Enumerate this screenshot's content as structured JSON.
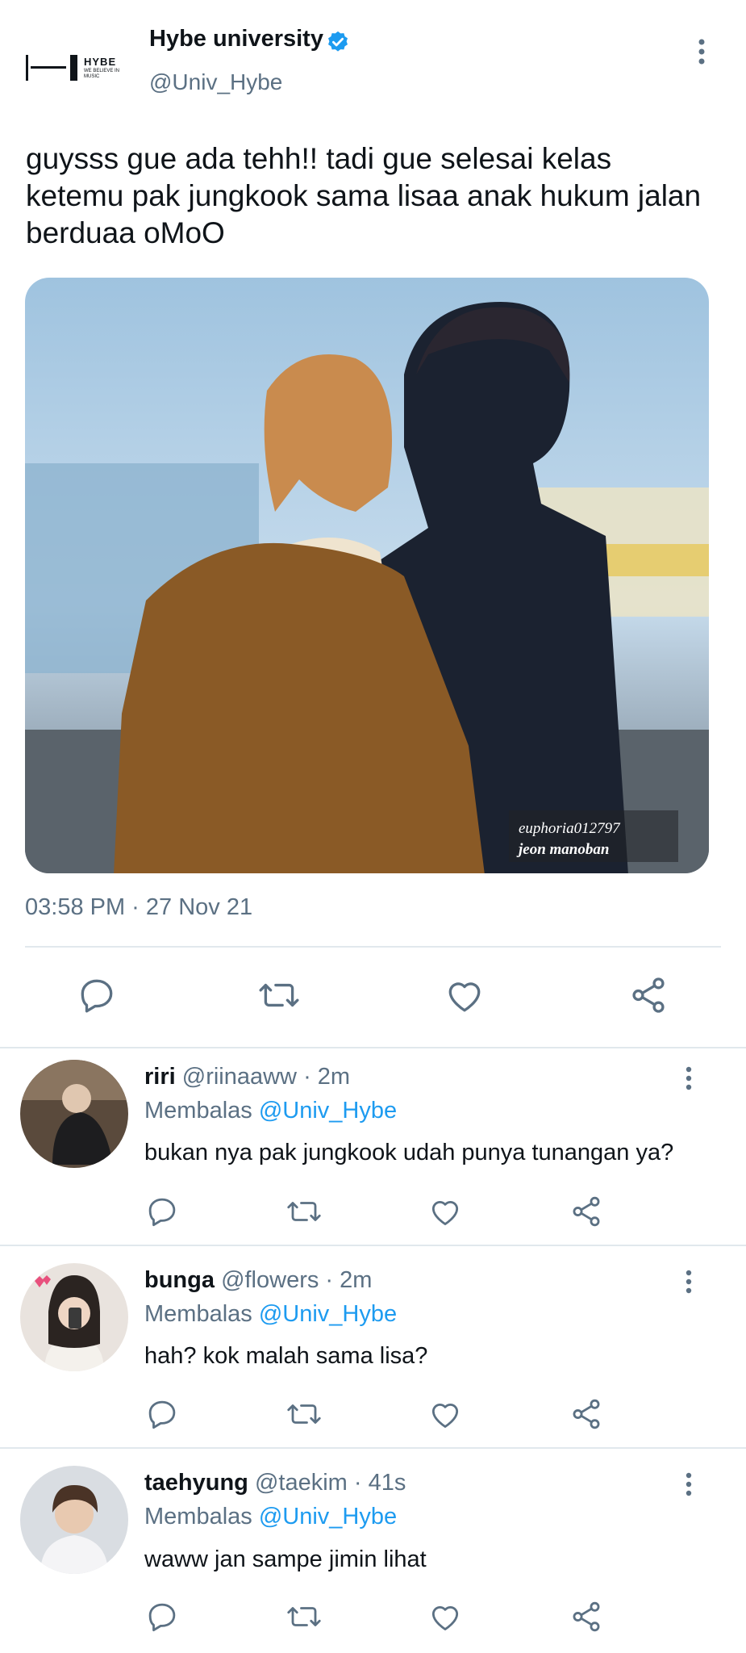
{
  "tweet": {
    "logo_text": "HYBE",
    "logo_sub": "WE BELIEVE IN MUSIC",
    "display_name": "Hybe university",
    "handle": "@Univ_Hybe",
    "text": "guysss gue ada tehh!! tadi gue selesai kelas ketemu pak jungkook sama lisaa anak hukum jalan berduaa oMoO",
    "watermark_line1": "euphoria012797",
    "watermark_line2": "jeon manoban",
    "timestamp": "03:58 PM · 27 Nov 21"
  },
  "reply_prefix": "Membalas",
  "reply_target": "@Univ_Hybe",
  "replies": [
    {
      "name": "riri",
      "handle": "@riinaaww",
      "time": "· 2m",
      "text": "bukan nya pak jungkook udah punya tunangan ya?"
    },
    {
      "name": "bunga",
      "handle": "@flowers",
      "time": "· 2m",
      "text": "hah? kok malah sama lisa?"
    },
    {
      "name": "taehyung",
      "handle": "@taekim",
      "time": "· 41s",
      "text": "waww jan sampe jimin lihat"
    }
  ],
  "colors": {
    "accent": "#1d9bf0",
    "secondary_text": "#5b7083",
    "divider": "#e1e8ed"
  },
  "icons": [
    "verified-badge-icon",
    "more-vertical-icon",
    "reply-icon",
    "retweet-icon",
    "like-icon",
    "share-icon"
  ]
}
